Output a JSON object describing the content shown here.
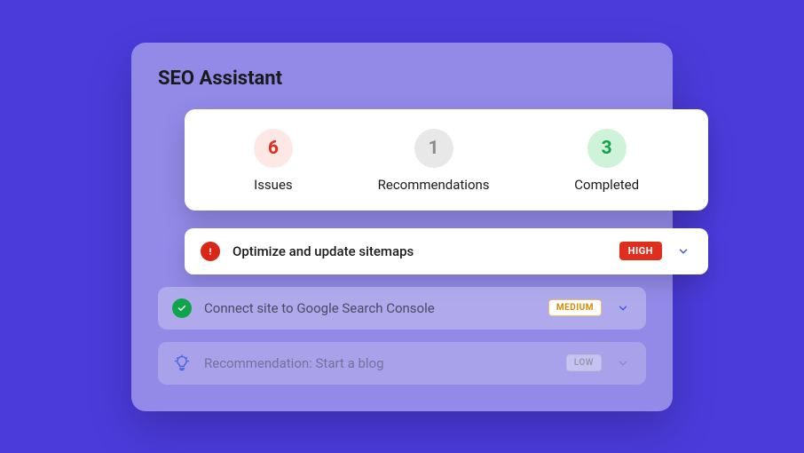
{
  "panel": {
    "title": "SEO Assistant"
  },
  "stats": {
    "issues": {
      "count": "6",
      "label": "Issues"
    },
    "recommendations": {
      "count": "1",
      "label": "Recommendations"
    },
    "completed": {
      "count": "3",
      "label": "Completed"
    }
  },
  "tasks": [
    {
      "title": "Optimize and update sitemaps",
      "priority": "HIGH"
    },
    {
      "title": "Connect site to Google Search Console",
      "priority": "MEDIUM"
    },
    {
      "title": "Recommendation: Start a blog",
      "priority": "LOW"
    }
  ],
  "colors": {
    "background": "#4B3BDB",
    "issuesCircle": "#FDE8E6",
    "issuesText": "#E02E1E",
    "completedCircle": "#CFF3D9",
    "completedText": "#0FA44A",
    "highBadge": "#E02E1E"
  }
}
